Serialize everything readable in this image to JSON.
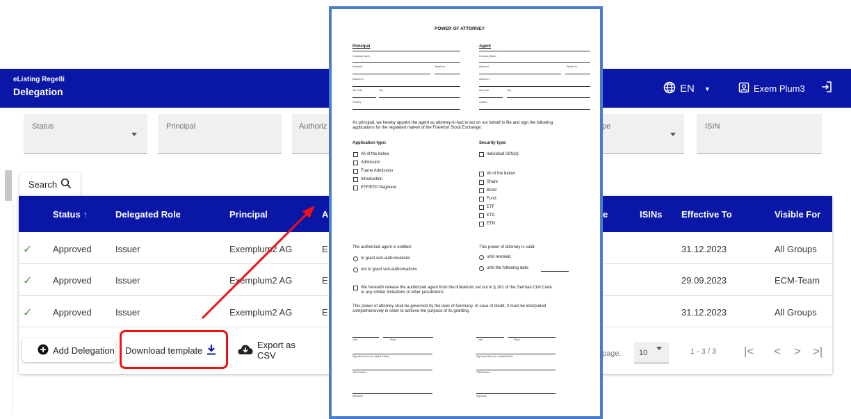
{
  "header": {
    "app_name": "eListing Regelli",
    "page_title": "Delegation",
    "language": "EN",
    "user": "Exem Plum3"
  },
  "filters": {
    "status": "Status",
    "principal": "Principal",
    "authorized": "Authoriz",
    "type_fragment": "pe",
    "isin": "ISIN"
  },
  "search": {
    "label": "Search"
  },
  "table": {
    "columns": [
      "Status",
      "Delegated Role",
      "Principal",
      "A",
      "e",
      "ISINs",
      "Effective To",
      "Visible For"
    ],
    "rows": [
      {
        "status": "Approved",
        "role": "Issuer",
        "principal": "Exemplum2 AG",
        "agent": "E",
        "effective": "31.12.2023",
        "visible": "All Groups"
      },
      {
        "status": "Approved",
        "role": "Issuer",
        "principal": "Exemplum2 AG",
        "agent": "E",
        "effective": "29.09.2023",
        "visible": "ECM-Team"
      },
      {
        "status": "Approved",
        "role": "Issuer",
        "principal": "Exemplum2 AG",
        "agent": "E",
        "effective": "31.12.2023",
        "visible": "All Groups"
      }
    ]
  },
  "footer": {
    "add_delegation": "Add Delegation",
    "download_template": "Download template",
    "export_csv": "Export as CSV",
    "page_label": "page:",
    "page_size": "10",
    "range": "1 - 3 / 3"
  },
  "document": {
    "title": "POWER OF ATTORNEY",
    "principal_heading": "Principal",
    "agent_heading": "Agent",
    "field_company": "Company Name",
    "field_address": "Address1",
    "field_street": "Street No.",
    "field_address2": "Address 2",
    "field_zip": "Zip Code",
    "field_city": "City",
    "field_country": "Country",
    "intro_line1": "As principal, we hereby appoint the agent as attorney-in-fact to act on our behalf to file and sign the following",
    "intro_line2": "applications for the regulated market of the Frankfurt Stock Exchange:",
    "app_type_heading": "Application type:",
    "app_types": [
      "All of the below",
      "Admission",
      "Frame Admission",
      "Introduction",
      "ETF/ETP-Segment"
    ],
    "sec_type_heading": "Security type:",
    "sec_individual": "Individual ISIN(s):",
    "sec_types": [
      "All of the below",
      "Share",
      "Bond",
      "Fund",
      "ETF",
      "ETC",
      "ETN"
    ],
    "entitled_heading": "The authorized agent is entitled:",
    "entitled_opts": [
      "to grant sub-authorisations",
      "not to grant sub-authorisations"
    ],
    "valid_heading": "This power of attorney is valid:",
    "valid_opts": [
      "until revoked.",
      "until the following date:"
    ],
    "release_line1": "We herewith release the authorized agent from the limitations set out in § 181 of the German Civil Code",
    "release_line2": "or any similar limitations of other jurisdictions.",
    "law_line1": "This power of attorney shall be governed by the laws of Germany. In case of doubt, it must be interpreted",
    "law_line2": "comprehensively in order to achieve the purpose of its granting.",
    "sig_date": "Date",
    "sig_place": "Place",
    "sig_name": "Signatory Name (in capital letters)",
    "sig_title": "Title/Position",
    "sig_signature": "Signature"
  },
  "colors": {
    "primary": "#0a17a6",
    "approved": "#43a047",
    "highlight": "#ee1111",
    "doc_border": "#4a7dc9"
  }
}
